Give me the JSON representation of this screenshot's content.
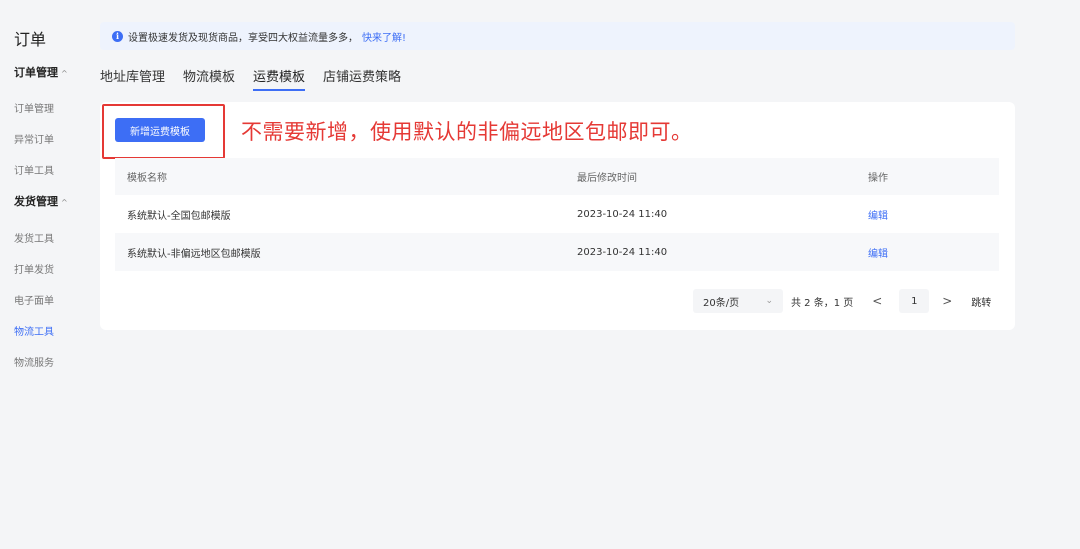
{
  "sidebar": {
    "title": "订单",
    "groups": [
      {
        "label": "订单管理",
        "caret": "^"
      },
      {
        "label": "发货管理",
        "caret": "^"
      }
    ],
    "items": [
      {
        "label": "订单管理"
      },
      {
        "label": "异常订单"
      },
      {
        "label": "订单工具"
      },
      {
        "label": "发货工具"
      },
      {
        "label": "打单发货"
      },
      {
        "label": "电子面单"
      },
      {
        "label": "物流工具"
      },
      {
        "label": "物流服务"
      }
    ]
  },
  "notice": {
    "icon": "info-icon",
    "text": "设置极速发货及现货商品，享受四大权益流量多多，",
    "link": "快来了解!"
  },
  "tabs": [
    {
      "label": "地址库管理"
    },
    {
      "label": "物流模板"
    },
    {
      "label": "运费模板"
    },
    {
      "label": "店铺运费策略"
    }
  ],
  "toolbar": {
    "add_label": "新增运费模板",
    "annotation": "不需要新增，使用默认的非偏远地区包邮即可。"
  },
  "table": {
    "headers": [
      "模板名称",
      "最后修改时间",
      "操作"
    ],
    "rows": [
      {
        "name": "系统默认-全国包邮模版",
        "time": "2023-10-24 11:40",
        "action": "编辑"
      },
      {
        "name": "系统默认-非偏远地区包邮模版",
        "time": "2023-10-24 11:40",
        "action": "编辑"
      }
    ]
  },
  "pagination": {
    "page_size": "20条/页",
    "total": "共 2 条，1 页",
    "prev": "<",
    "current": "1",
    "next": ">",
    "jump": "跳转"
  },
  "colors": {
    "accent": "#3d6ef5",
    "annotation": "#e53935"
  }
}
